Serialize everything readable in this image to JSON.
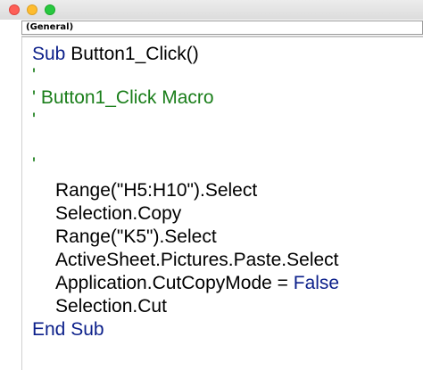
{
  "window": {
    "controls": [
      "close",
      "minimize",
      "zoom"
    ]
  },
  "object_selector": {
    "value": "(General)"
  },
  "code": {
    "sub_keyword": "Sub",
    "sub_name": " Button1_Click()",
    "comment1": "'",
    "comment2": "' Button1_Click Macro",
    "comment3": "'",
    "comment4": "'",
    "line1": "Range(\"H5:H10\").Select",
    "line2": "Selection.Copy",
    "line3": "Range(\"K5\").Select",
    "line4": "ActiveSheet.Pictures.Paste.Select",
    "line5_prefix": "Application.CutCopyMode = ",
    "line5_keyword": "False",
    "line6": "Selection.Cut",
    "end_sub": "End Sub"
  },
  "colors": {
    "keyword": "#0b1f8a",
    "comment": "#1a7e1a",
    "text": "#000000"
  }
}
